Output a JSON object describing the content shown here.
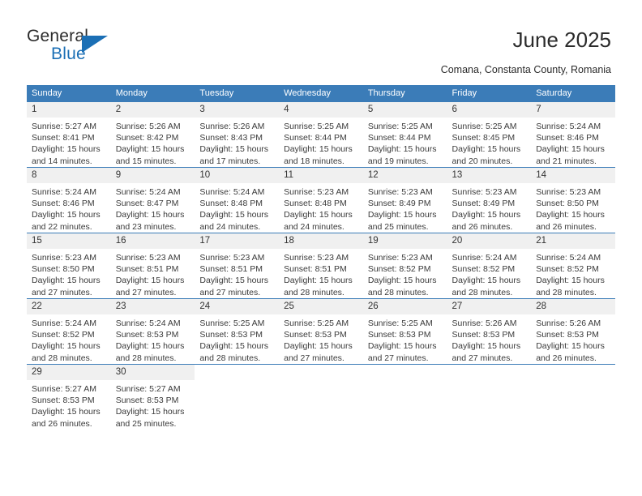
{
  "brand": {
    "name_top": "General",
    "name_bottom": "Blue",
    "triangle_icon": "triangle-icon",
    "accent_color": "#1b6fb5"
  },
  "header": {
    "title": "June 2025",
    "subtitle": "Comana, Constanta County, Romania"
  },
  "colors": {
    "header_blue": "#3b7cb8",
    "daynum_band": "#f0f0f0",
    "text": "#333333"
  },
  "calendar": {
    "weekday_headers": [
      "Sunday",
      "Monday",
      "Tuesday",
      "Wednesday",
      "Thursday",
      "Friday",
      "Saturday"
    ],
    "labels": {
      "sunrise": "Sunrise:",
      "sunset": "Sunset:",
      "daylight": "Daylight:"
    },
    "weeks": [
      [
        {
          "day": "1",
          "sunrise": "Sunrise: 5:27 AM",
          "sunset": "Sunset: 8:41 PM",
          "daylight_1": "Daylight: 15 hours",
          "daylight_2": "and 14 minutes."
        },
        {
          "day": "2",
          "sunrise": "Sunrise: 5:26 AM",
          "sunset": "Sunset: 8:42 PM",
          "daylight_1": "Daylight: 15 hours",
          "daylight_2": "and 15 minutes."
        },
        {
          "day": "3",
          "sunrise": "Sunrise: 5:26 AM",
          "sunset": "Sunset: 8:43 PM",
          "daylight_1": "Daylight: 15 hours",
          "daylight_2": "and 17 minutes."
        },
        {
          "day": "4",
          "sunrise": "Sunrise: 5:25 AM",
          "sunset": "Sunset: 8:44 PM",
          "daylight_1": "Daylight: 15 hours",
          "daylight_2": "and 18 minutes."
        },
        {
          "day": "5",
          "sunrise": "Sunrise: 5:25 AM",
          "sunset": "Sunset: 8:44 PM",
          "daylight_1": "Daylight: 15 hours",
          "daylight_2": "and 19 minutes."
        },
        {
          "day": "6",
          "sunrise": "Sunrise: 5:25 AM",
          "sunset": "Sunset: 8:45 PM",
          "daylight_1": "Daylight: 15 hours",
          "daylight_2": "and 20 minutes."
        },
        {
          "day": "7",
          "sunrise": "Sunrise: 5:24 AM",
          "sunset": "Sunset: 8:46 PM",
          "daylight_1": "Daylight: 15 hours",
          "daylight_2": "and 21 minutes."
        }
      ],
      [
        {
          "day": "8",
          "sunrise": "Sunrise: 5:24 AM",
          "sunset": "Sunset: 8:46 PM",
          "daylight_1": "Daylight: 15 hours",
          "daylight_2": "and 22 minutes."
        },
        {
          "day": "9",
          "sunrise": "Sunrise: 5:24 AM",
          "sunset": "Sunset: 8:47 PM",
          "daylight_1": "Daylight: 15 hours",
          "daylight_2": "and 23 minutes."
        },
        {
          "day": "10",
          "sunrise": "Sunrise: 5:24 AM",
          "sunset": "Sunset: 8:48 PM",
          "daylight_1": "Daylight: 15 hours",
          "daylight_2": "and 24 minutes."
        },
        {
          "day": "11",
          "sunrise": "Sunrise: 5:23 AM",
          "sunset": "Sunset: 8:48 PM",
          "daylight_1": "Daylight: 15 hours",
          "daylight_2": "and 24 minutes."
        },
        {
          "day": "12",
          "sunrise": "Sunrise: 5:23 AM",
          "sunset": "Sunset: 8:49 PM",
          "daylight_1": "Daylight: 15 hours",
          "daylight_2": "and 25 minutes."
        },
        {
          "day": "13",
          "sunrise": "Sunrise: 5:23 AM",
          "sunset": "Sunset: 8:49 PM",
          "daylight_1": "Daylight: 15 hours",
          "daylight_2": "and 26 minutes."
        },
        {
          "day": "14",
          "sunrise": "Sunrise: 5:23 AM",
          "sunset": "Sunset: 8:50 PM",
          "daylight_1": "Daylight: 15 hours",
          "daylight_2": "and 26 minutes."
        }
      ],
      [
        {
          "day": "15",
          "sunrise": "Sunrise: 5:23 AM",
          "sunset": "Sunset: 8:50 PM",
          "daylight_1": "Daylight: 15 hours",
          "daylight_2": "and 27 minutes."
        },
        {
          "day": "16",
          "sunrise": "Sunrise: 5:23 AM",
          "sunset": "Sunset: 8:51 PM",
          "daylight_1": "Daylight: 15 hours",
          "daylight_2": "and 27 minutes."
        },
        {
          "day": "17",
          "sunrise": "Sunrise: 5:23 AM",
          "sunset": "Sunset: 8:51 PM",
          "daylight_1": "Daylight: 15 hours",
          "daylight_2": "and 27 minutes."
        },
        {
          "day": "18",
          "sunrise": "Sunrise: 5:23 AM",
          "sunset": "Sunset: 8:51 PM",
          "daylight_1": "Daylight: 15 hours",
          "daylight_2": "and 28 minutes."
        },
        {
          "day": "19",
          "sunrise": "Sunrise: 5:23 AM",
          "sunset": "Sunset: 8:52 PM",
          "daylight_1": "Daylight: 15 hours",
          "daylight_2": "and 28 minutes."
        },
        {
          "day": "20",
          "sunrise": "Sunrise: 5:24 AM",
          "sunset": "Sunset: 8:52 PM",
          "daylight_1": "Daylight: 15 hours",
          "daylight_2": "and 28 minutes."
        },
        {
          "day": "21",
          "sunrise": "Sunrise: 5:24 AM",
          "sunset": "Sunset: 8:52 PM",
          "daylight_1": "Daylight: 15 hours",
          "daylight_2": "and 28 minutes."
        }
      ],
      [
        {
          "day": "22",
          "sunrise": "Sunrise: 5:24 AM",
          "sunset": "Sunset: 8:52 PM",
          "daylight_1": "Daylight: 15 hours",
          "daylight_2": "and 28 minutes."
        },
        {
          "day": "23",
          "sunrise": "Sunrise: 5:24 AM",
          "sunset": "Sunset: 8:53 PM",
          "daylight_1": "Daylight: 15 hours",
          "daylight_2": "and 28 minutes."
        },
        {
          "day": "24",
          "sunrise": "Sunrise: 5:25 AM",
          "sunset": "Sunset: 8:53 PM",
          "daylight_1": "Daylight: 15 hours",
          "daylight_2": "and 28 minutes."
        },
        {
          "day": "25",
          "sunrise": "Sunrise: 5:25 AM",
          "sunset": "Sunset: 8:53 PM",
          "daylight_1": "Daylight: 15 hours",
          "daylight_2": "and 27 minutes."
        },
        {
          "day": "26",
          "sunrise": "Sunrise: 5:25 AM",
          "sunset": "Sunset: 8:53 PM",
          "daylight_1": "Daylight: 15 hours",
          "daylight_2": "and 27 minutes."
        },
        {
          "day": "27",
          "sunrise": "Sunrise: 5:26 AM",
          "sunset": "Sunset: 8:53 PM",
          "daylight_1": "Daylight: 15 hours",
          "daylight_2": "and 27 minutes."
        },
        {
          "day": "28",
          "sunrise": "Sunrise: 5:26 AM",
          "sunset": "Sunset: 8:53 PM",
          "daylight_1": "Daylight: 15 hours",
          "daylight_2": "and 26 minutes."
        }
      ],
      [
        {
          "day": "29",
          "sunrise": "Sunrise: 5:27 AM",
          "sunset": "Sunset: 8:53 PM",
          "daylight_1": "Daylight: 15 hours",
          "daylight_2": "and 26 minutes."
        },
        {
          "day": "30",
          "sunrise": "Sunrise: 5:27 AM",
          "sunset": "Sunset: 8:53 PM",
          "daylight_1": "Daylight: 15 hours",
          "daylight_2": "and 25 minutes."
        },
        {
          "day": "",
          "sunrise": "",
          "sunset": "",
          "daylight_1": "",
          "daylight_2": ""
        },
        {
          "day": "",
          "sunrise": "",
          "sunset": "",
          "daylight_1": "",
          "daylight_2": ""
        },
        {
          "day": "",
          "sunrise": "",
          "sunset": "",
          "daylight_1": "",
          "daylight_2": ""
        },
        {
          "day": "",
          "sunrise": "",
          "sunset": "",
          "daylight_1": "",
          "daylight_2": ""
        },
        {
          "day": "",
          "sunrise": "",
          "sunset": "",
          "daylight_1": "",
          "daylight_2": ""
        }
      ]
    ]
  }
}
